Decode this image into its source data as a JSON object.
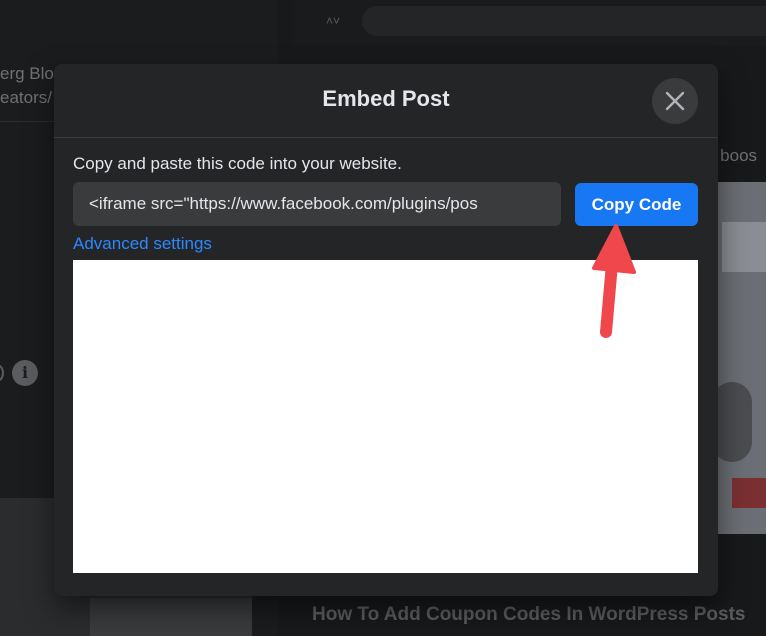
{
  "background": {
    "left_text_lines": [
      "erg Blo",
      "eators/"
    ],
    "right_text": "o boos",
    "bottom_title": "How To Add Coupon Codes In WordPress Posts",
    "info_icon": "info-icon"
  },
  "modal": {
    "title": "Embed Post",
    "close_icon": "close-icon",
    "instructions": "Copy and paste this code into your website.",
    "code_value": "<iframe src=\"https://www.facebook.com/plugins/pos",
    "copy_button_label": "Copy Code",
    "advanced_settings_label": "Advanced settings"
  },
  "annotation": {
    "arrow_color": "#f0474d"
  },
  "colors": {
    "accent": "#1877f2",
    "link": "#2d88ff",
    "modal_bg": "#242526",
    "page_bg": "#18191a"
  }
}
